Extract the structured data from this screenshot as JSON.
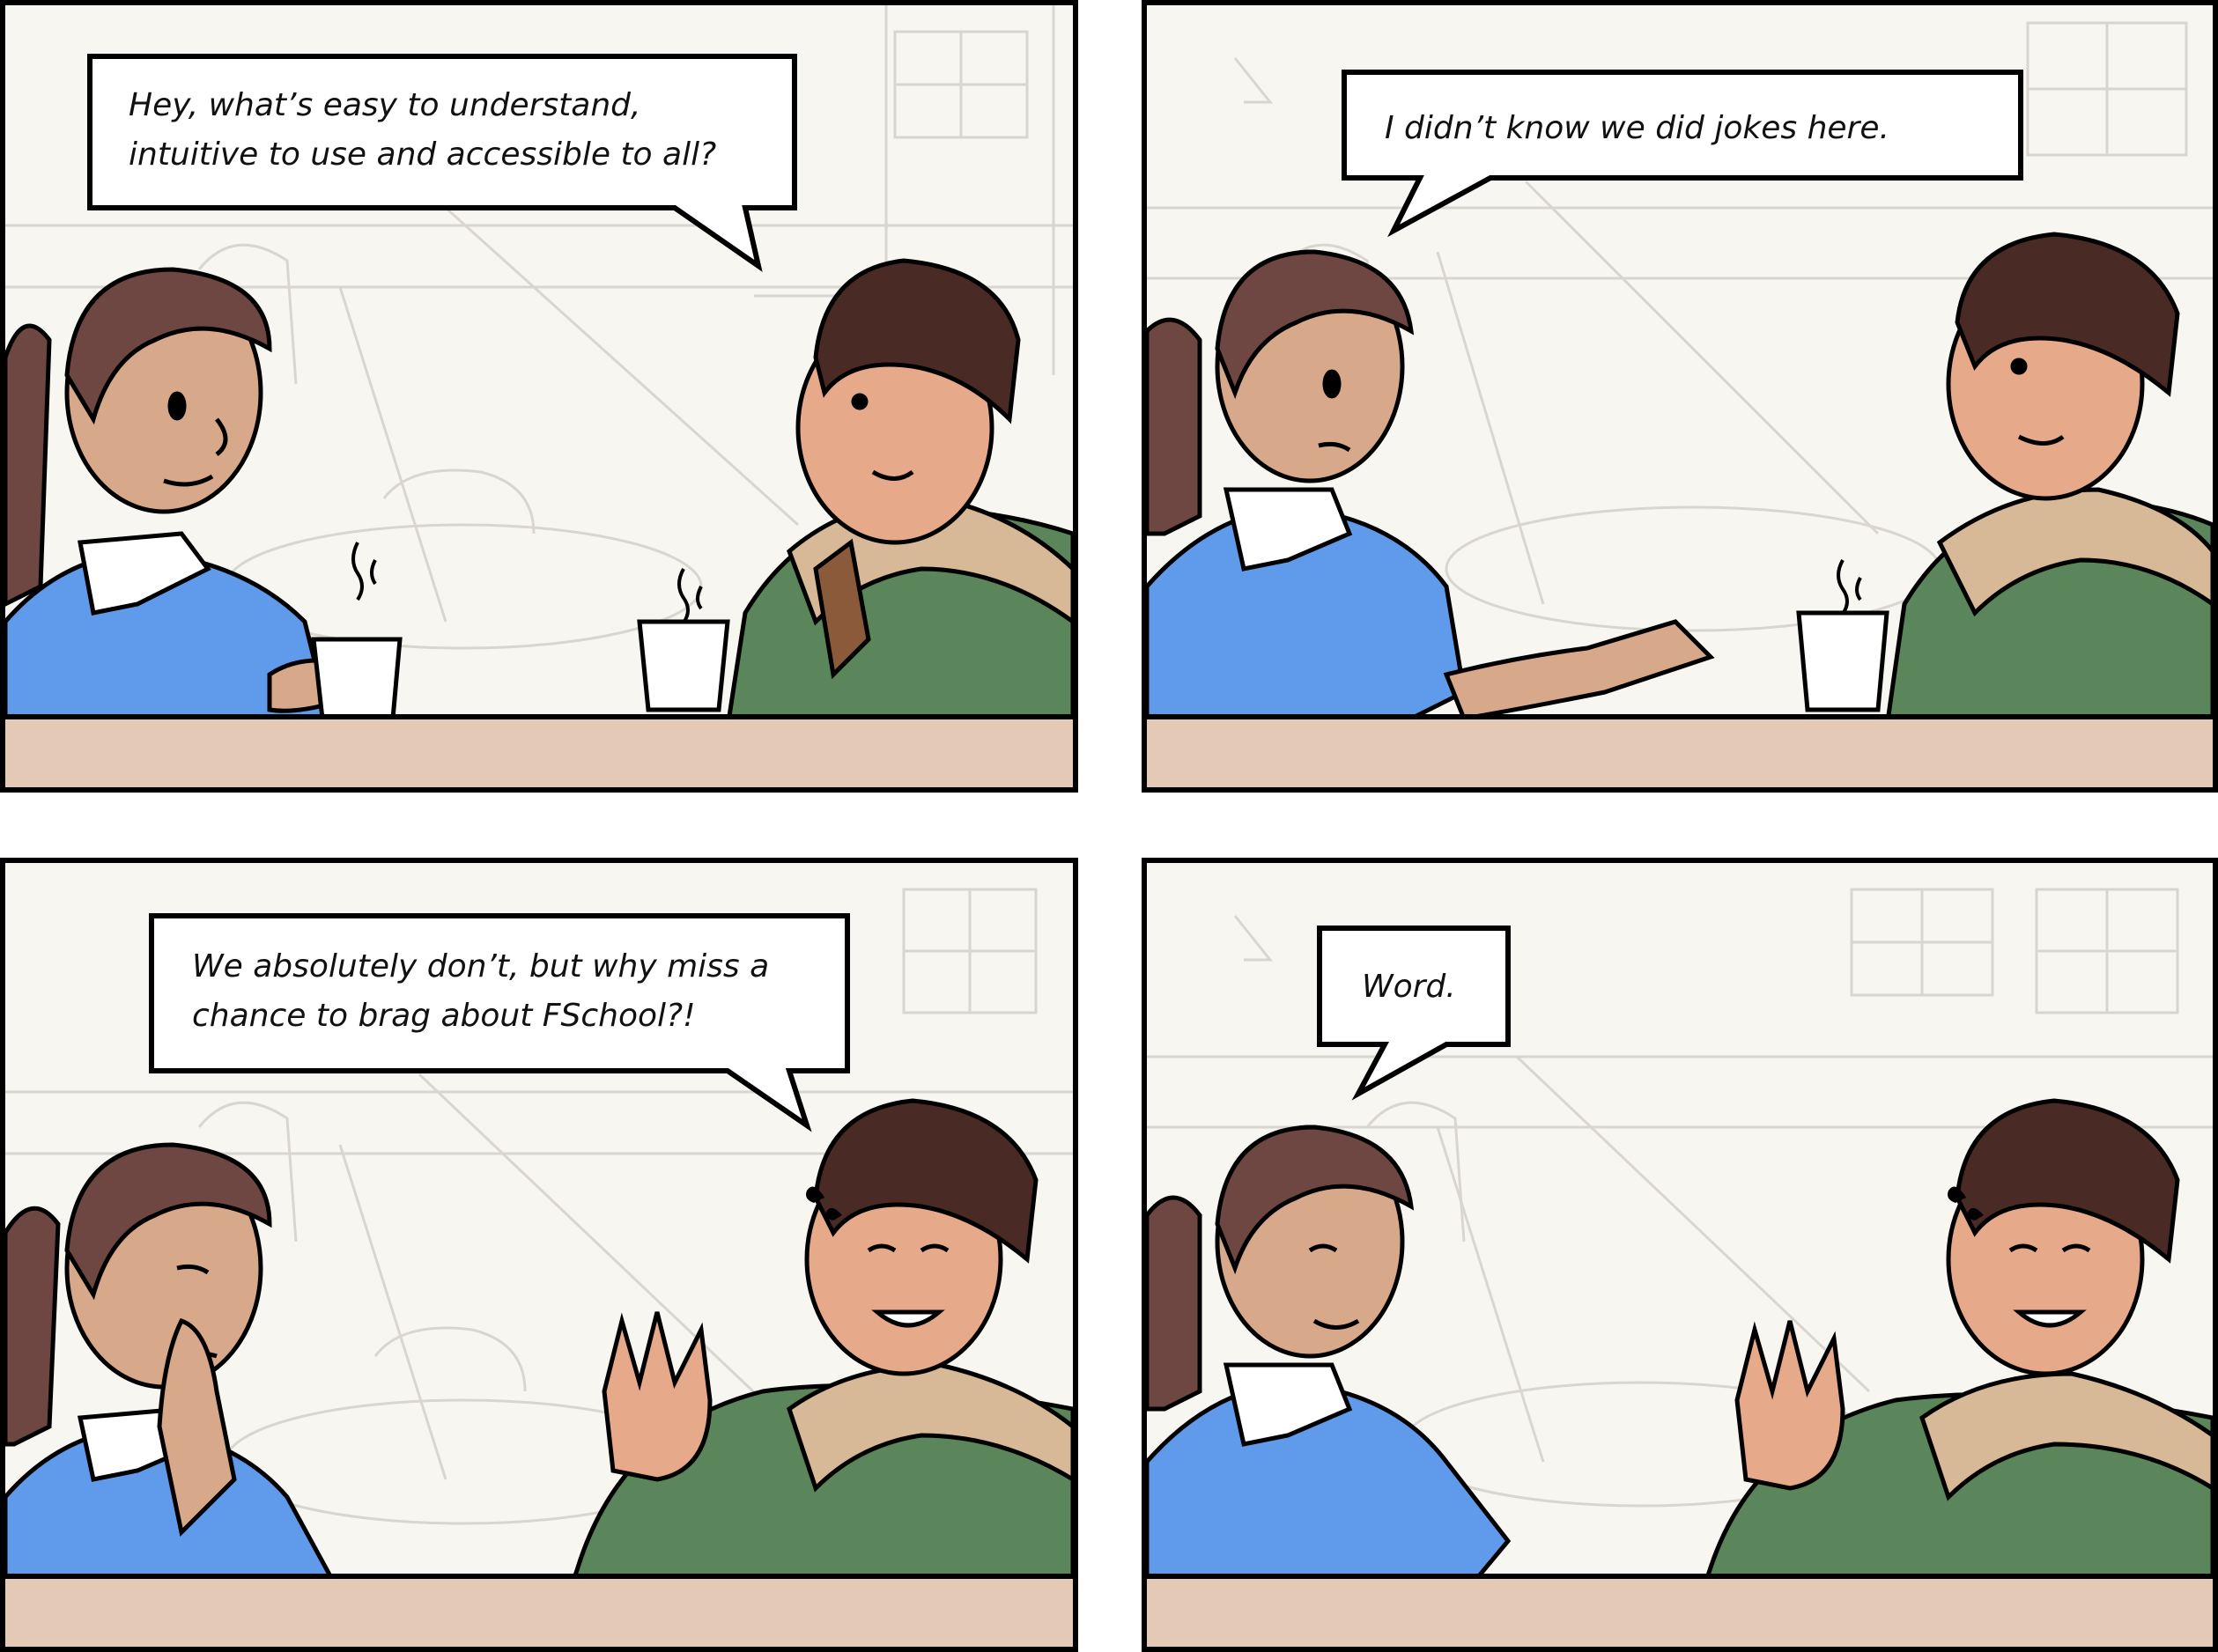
{
  "comic": {
    "panels": [
      {
        "speaker": "woman",
        "bubble_lines": [
          "Hey, what’s easy to understand,",
          "intuitive to use and accessible to all?"
        ]
      },
      {
        "speaker": "woman",
        "bubble_lines": [
          "I didn’t know we did jokes here."
        ]
      },
      {
        "speaker": "woman",
        "bubble_lines": [
          "We absolutely don’t, but why miss a",
          "chance to brag about FSchool?!"
        ]
      },
      {
        "speaker": "woman",
        "bubble_lines": [
          "Word."
        ]
      }
    ]
  },
  "colors": {
    "panel_bg": "#f8f6f0",
    "line_art": "#d9d6cf",
    "table": "#e3c9b6",
    "skin": "#d8a88a",
    "hair": "#6e4742",
    "man_hair": "#4a2a24",
    "sweater_blue": "#5f9bea",
    "jacket_green": "#5b855b",
    "jacket_beige": "#d7b897",
    "outline": "#000000"
  },
  "icons": [
    "steam-icon",
    "coffee-cup-icon",
    "sweat-drops-icon"
  ]
}
